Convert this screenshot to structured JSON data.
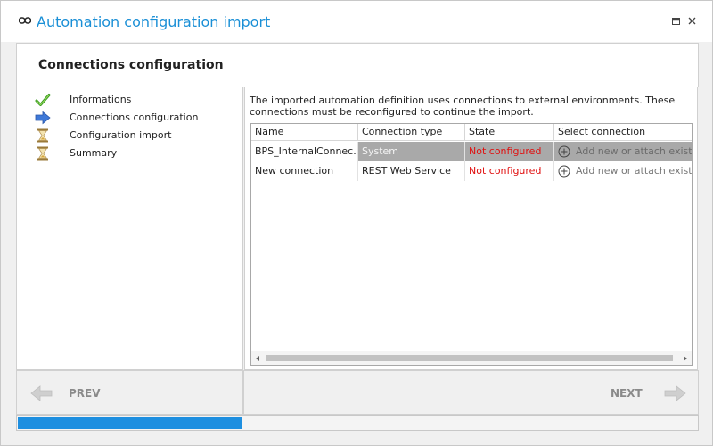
{
  "window": {
    "title": "Automation configuration import",
    "title_color": "#1a8fd6"
  },
  "header": {
    "title": "Connections configuration"
  },
  "steps": [
    {
      "label": "Informations",
      "icon": "checkmark-icon",
      "status": "done"
    },
    {
      "label": "Connections configuration",
      "icon": "right-arrow-icon",
      "status": "current"
    },
    {
      "label": "Configuration import",
      "icon": "hourglass-icon",
      "status": "pending"
    },
    {
      "label": "Summary",
      "icon": "hourglass-icon",
      "status": "pending"
    }
  ],
  "main": {
    "description": "The imported automation definition uses connections to external environments. These connections must be reconfigured to continue the import.",
    "grid": {
      "columns": [
        "Name",
        "Connection type",
        "State",
        "Select connection"
      ],
      "rows": [
        {
          "name": "BPS_InternalConnec...",
          "type": "System",
          "state": "Not configured",
          "select": "Add new or attach existing",
          "selected": true
        },
        {
          "name": "New connection",
          "type": "REST Web Service",
          "state": "Not configured",
          "select": "Add new or attach existing",
          "selected": false
        }
      ]
    }
  },
  "nav": {
    "prev_label": "PREV",
    "next_label": "NEXT"
  },
  "progress": {
    "value": 0.33,
    "color": "#1e8fe0"
  },
  "colors": {
    "error": "#e01010",
    "selection": "#a9a9a9"
  }
}
